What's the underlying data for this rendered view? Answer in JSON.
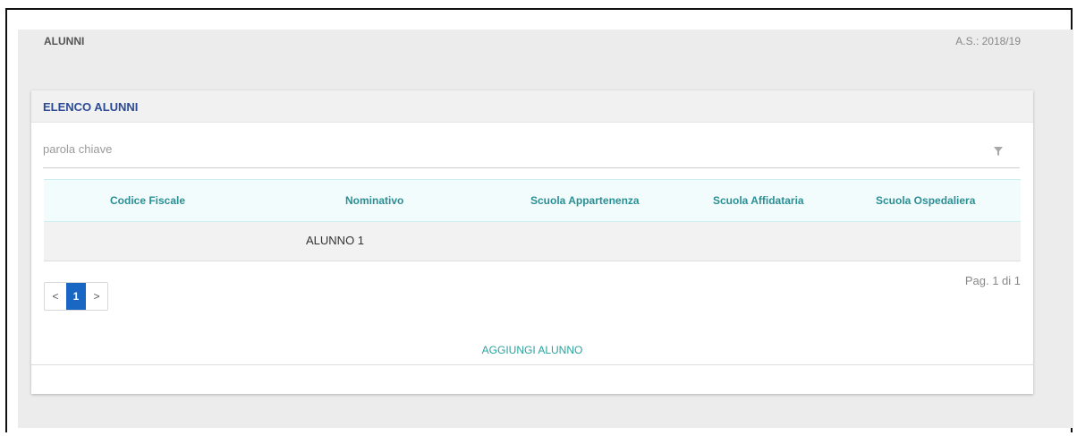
{
  "header": {
    "title": "ALUNNI",
    "school_year": "A.S.: 2018/19"
  },
  "card": {
    "title": "ELENCO ALUNNI"
  },
  "search": {
    "placeholder": "parola chiave",
    "value": ""
  },
  "icons": {
    "filter": "filter-icon"
  },
  "table": {
    "columns": [
      "Codice Fiscale",
      "Nominativo",
      "Scuola Appartenenza",
      "Scuola Affidataria",
      "Scuola Ospedaliera"
    ],
    "rows": [
      {
        "codice_fiscale": "",
        "nominativo": "ALUNNO 1",
        "scuola_appartenenza": "",
        "scuola_affidataria": "",
        "scuola_ospedaliera": ""
      }
    ]
  },
  "pagination": {
    "prev": "<",
    "current": "1",
    "next": ">",
    "info": "Pag. 1 di 1"
  },
  "actions": {
    "add_label": "AGGIUNGI ALUNNO"
  },
  "colors": {
    "title_blue": "#2d4a94",
    "teal": "#2a8f95",
    "active_page": "#1967c2"
  }
}
